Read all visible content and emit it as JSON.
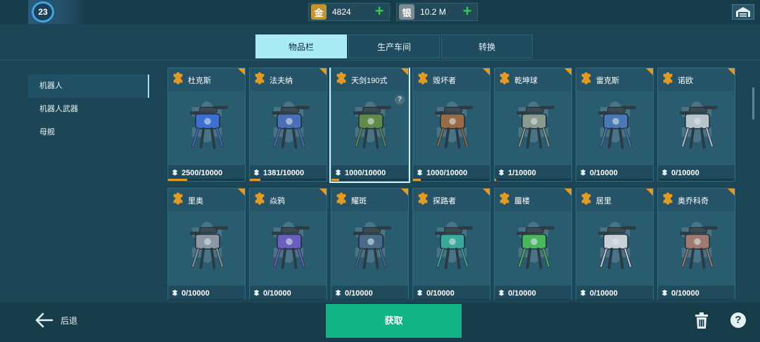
{
  "player": {
    "level": "23"
  },
  "currencies": [
    {
      "icon": "金",
      "value": "4824",
      "type": "gold"
    },
    {
      "icon": "银",
      "value": "10.2 M",
      "type": "silver"
    }
  ],
  "tabs": [
    {
      "label": "物品栏",
      "active": true
    },
    {
      "label": "生产车间",
      "active": false
    },
    {
      "label": "转换",
      "active": false
    }
  ],
  "sidebar": {
    "items": [
      {
        "label": "机器人",
        "active": true
      },
      {
        "label": "机器人武器",
        "active": false
      },
      {
        "label": "母舰",
        "active": false
      }
    ]
  },
  "cards": [
    {
      "name": "杜克斯",
      "count": "2500/10000",
      "progress": 0.25,
      "color": "#3b6fd1"
    },
    {
      "name": "法夫纳",
      "count": "1381/10000",
      "progress": 0.1381,
      "color": "#4a6fb8"
    },
    {
      "name": "天剑190式",
      "count": "1000/10000",
      "progress": 0.1,
      "color": "#5f8a4a",
      "selected": true,
      "help": "?"
    },
    {
      "name": "毁坏者",
      "count": "1000/10000",
      "progress": 0.1,
      "color": "#9a6a45"
    },
    {
      "name": "乾坤球",
      "count": "1/10000",
      "progress": 0.0001,
      "color": "#8a9a8c"
    },
    {
      "name": "雷克斯",
      "count": "0/10000",
      "progress": 0,
      "color": "#4a78b4"
    },
    {
      "name": "诺欧",
      "count": "0/10000",
      "progress": 0,
      "color": "#b8c4cc"
    },
    {
      "name": "里奥",
      "count": "0/10000",
      "progress": 0,
      "color": "#8c98a4"
    },
    {
      "name": "焱鸦",
      "count": "0/10000",
      "progress": 0,
      "color": "#6a5fc0"
    },
    {
      "name": "耀斑",
      "count": "0/10000",
      "progress": 0,
      "color": "#4a6a8a"
    },
    {
      "name": "探路者",
      "count": "0/10000",
      "progress": 0,
      "color": "#3aa89a"
    },
    {
      "name": "蜃楼",
      "count": "0/10000",
      "progress": 0,
      "color": "#4ab85a"
    },
    {
      "name": "居里",
      "count": "0/10000",
      "progress": 0,
      "color": "#c8d0d6"
    },
    {
      "name": "奥乔科奇",
      "count": "0/10000",
      "progress": 0,
      "color": "#a07a70"
    }
  ],
  "bottom": {
    "back_label": "后退",
    "get_label": "获取",
    "help_label": "?"
  },
  "colors": {
    "accent": "#e39a1f",
    "primary_button": "#12b686",
    "background": "#1c4656"
  }
}
